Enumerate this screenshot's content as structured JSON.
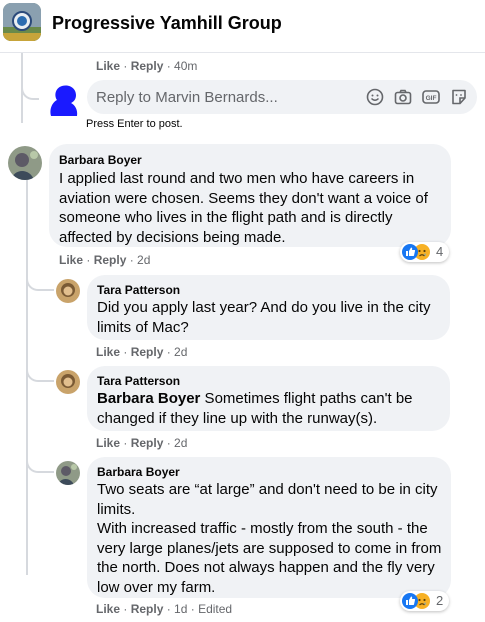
{
  "group": {
    "title": "Progressive Yamhill Group",
    "avatar_icon": "group-photo-icon"
  },
  "top_meta": {
    "like": "Like",
    "sep": " · ",
    "reply": "Reply",
    "time": "40m"
  },
  "reply_box": {
    "placeholder": "Reply to Marvin Bernards...",
    "icons": [
      "emoji-icon",
      "camera-icon",
      "gif-icon",
      "sticker-icon"
    ],
    "hint": "Press Enter to post."
  },
  "comments": [
    {
      "author": "Barbara Boyer",
      "text": "I applied last round and two men who have careers in aviation were chosen. Seems they don't want a voice of someone who lives in the flight path and is directly affected by decisions being made.",
      "like": "Like",
      "reply": "Reply",
      "time": "2d",
      "reactions": {
        "icons": [
          "like-reaction-icon",
          "sad-reaction-icon"
        ],
        "count": "4"
      },
      "replies": [
        {
          "author": "Tara Patterson",
          "text": "Did you apply last year? And do you live in the city limits of Mac?",
          "like": "Like",
          "reply": "Reply",
          "time": "2d"
        },
        {
          "author": "Tara Patterson",
          "mention": "Barbara Boyer",
          "text": " Sometimes flight paths can't be changed if they line up with the runway(s).",
          "like": "Like",
          "reply": "Reply",
          "time": "2d"
        },
        {
          "author": "Barbara Boyer",
          "text_lines": [
            "Two seats are “at large” and don't need to be in city limits.",
            "With increased traffic - mostly from the south - the very large planes/jets are supposed to come in from the north. Does not always happen and the fly very low over my farm."
          ],
          "like": "Like",
          "reply": "Reply",
          "time": "1d",
          "edited": "Edited",
          "reactions": {
            "icons": [
              "like-reaction-icon",
              "sad-reaction-icon"
            ],
            "count": "2"
          }
        }
      ]
    }
  ],
  "colors": {
    "like_blue": "#1877f2",
    "sad_yellow": "#f7b125",
    "meta_gray": "#65676b",
    "bubble_bg": "#f0f2f5"
  }
}
